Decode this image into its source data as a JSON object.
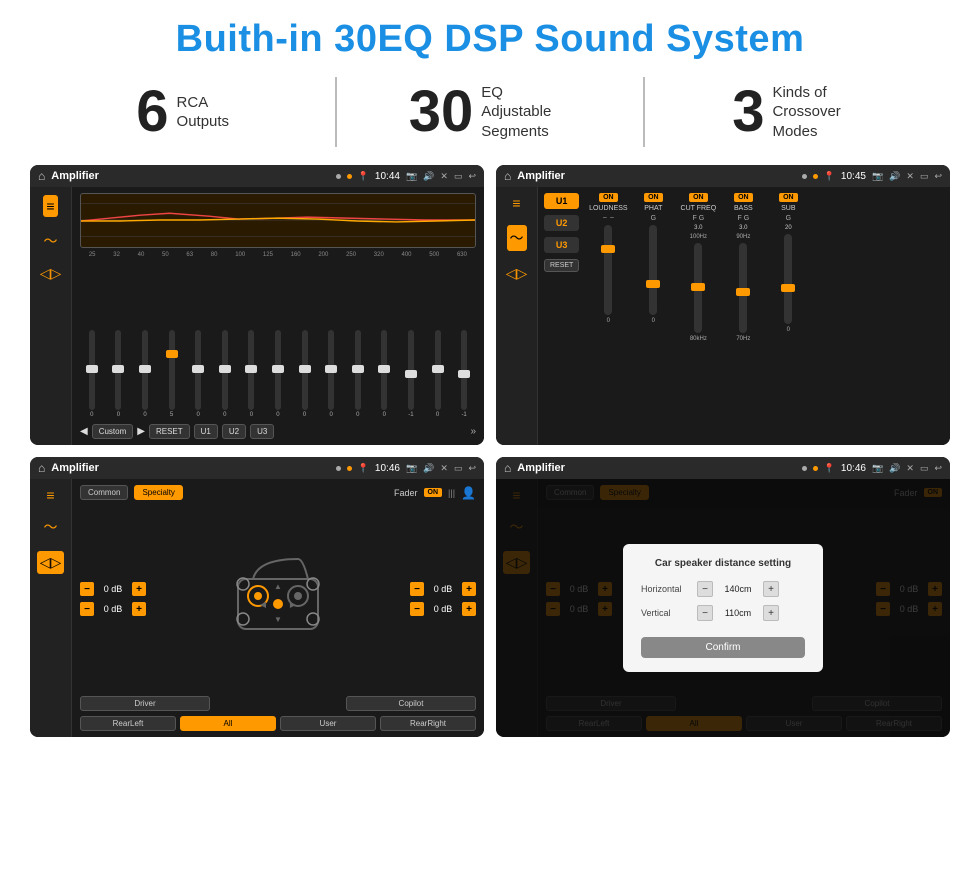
{
  "page": {
    "title": "Buith-in 30EQ DSP Sound System",
    "stats": [
      {
        "number": "6",
        "label": "RCA\nOutputs"
      },
      {
        "number": "30",
        "label": "EQ Adjustable\nSegments"
      },
      {
        "number": "3",
        "label": "Kinds of\nCrossover Modes"
      }
    ],
    "screens": [
      {
        "id": "screen1",
        "app": "Amplifier",
        "time": "10:44",
        "type": "eq"
      },
      {
        "id": "screen2",
        "app": "Amplifier",
        "time": "10:45",
        "type": "crossover"
      },
      {
        "id": "screen3",
        "app": "Amplifier",
        "time": "10:46",
        "type": "fader"
      },
      {
        "id": "screen4",
        "app": "Amplifier",
        "time": "10:46",
        "type": "distance"
      }
    ],
    "eq": {
      "preset": "Custom",
      "freqs": [
        "25",
        "32",
        "40",
        "50",
        "63",
        "80",
        "100",
        "125",
        "160",
        "200",
        "250",
        "320",
        "400",
        "500",
        "630"
      ],
      "values": [
        "0",
        "0",
        "0",
        "5",
        "0",
        "0",
        "0",
        "0",
        "0",
        "0",
        "0",
        "0",
        "-1",
        "0",
        "-1"
      ],
      "buttons": [
        "RESET",
        "U1",
        "U2",
        "U3"
      ]
    },
    "crossover": {
      "u_buttons": [
        "U1",
        "U2",
        "U3"
      ],
      "channels": [
        "LOUDNESS",
        "PHAT",
        "CUT FREQ",
        "BASS",
        "SUB"
      ],
      "reset": "RESET"
    },
    "fader": {
      "tabs": [
        "Common",
        "Specialty"
      ],
      "active_tab": "Specialty",
      "fader_label": "Fader",
      "on": "ON",
      "footer_buttons": [
        "Driver",
        "",
        "Copilot",
        "RearLeft",
        "All",
        "User",
        "RearRight"
      ],
      "active_footer": "All"
    },
    "distance": {
      "dialog_title": "Car speaker distance setting",
      "horizontal_label": "Horizontal",
      "horizontal_value": "140cm",
      "vertical_label": "Vertical",
      "vertical_value": "110cm",
      "confirm_label": "Confirm"
    }
  }
}
